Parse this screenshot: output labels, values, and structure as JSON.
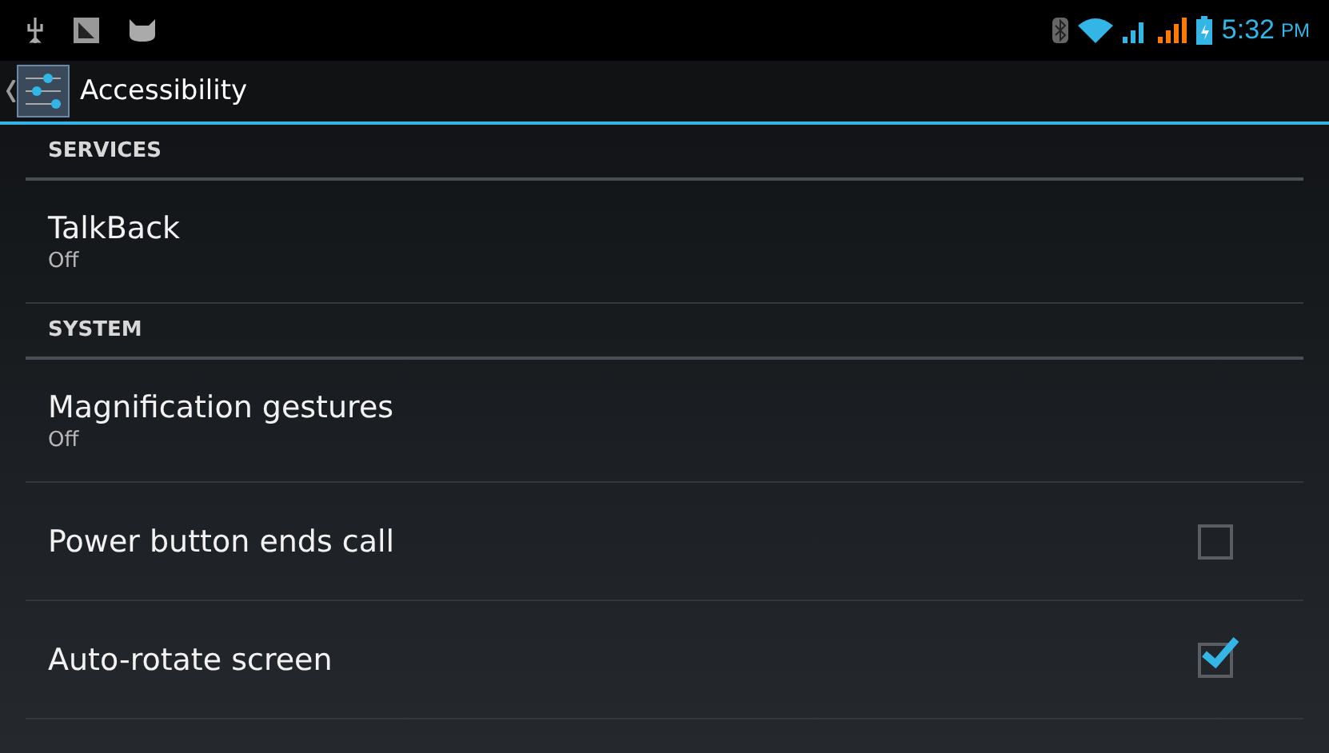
{
  "status_bar": {
    "time": "5:32",
    "meridiem": "PM"
  },
  "action_bar": {
    "title": "Accessibility"
  },
  "list": [
    {
      "kind": "header",
      "title": "SERVICES"
    },
    {
      "kind": "summary",
      "title": "TalkBack",
      "summary": "Off"
    },
    {
      "kind": "header",
      "title": "SYSTEM"
    },
    {
      "kind": "summary",
      "title": "Magnification gestures",
      "summary": "Off"
    },
    {
      "kind": "checkbox",
      "title": "Power button ends call",
      "checked": false
    },
    {
      "kind": "checkbox",
      "title": "Auto-rotate screen",
      "checked": true
    }
  ]
}
